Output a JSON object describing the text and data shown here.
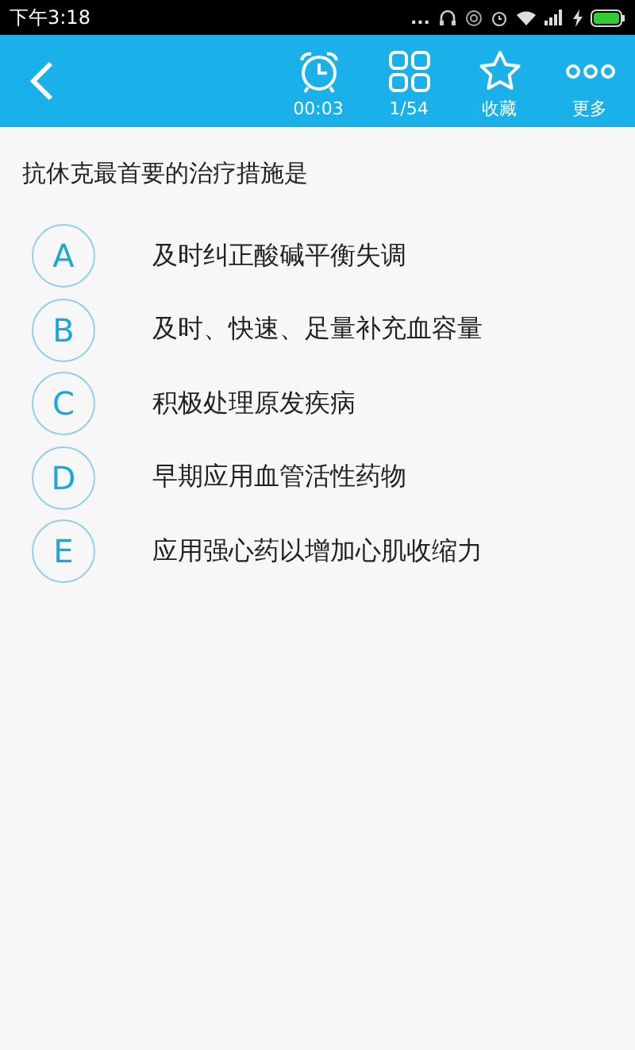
{
  "status_bar": {
    "time": "下午3:18",
    "dots": "..."
  },
  "toolbar": {
    "items": [
      {
        "kind": "timer",
        "label": "00:03"
      },
      {
        "kind": "grid",
        "label": "1/54"
      },
      {
        "kind": "star",
        "label": "收藏"
      },
      {
        "kind": "more",
        "label": "更多"
      }
    ]
  },
  "question": "抗休克最首要的治疗措施是",
  "options": [
    {
      "letter": "A",
      "text": "及时纠正酸碱平衡失调",
      "selected": false
    },
    {
      "letter": "B",
      "text": "及时、快速、足量补充血容量",
      "selected": false
    },
    {
      "letter": "C",
      "text": "积极处理原发疾病",
      "selected": false
    },
    {
      "letter": "D",
      "text": "早期应用血管活性药物",
      "selected": false
    },
    {
      "letter": "E",
      "text": "应用强心药以增加心肌收缩力",
      "selected": false
    }
  ]
}
